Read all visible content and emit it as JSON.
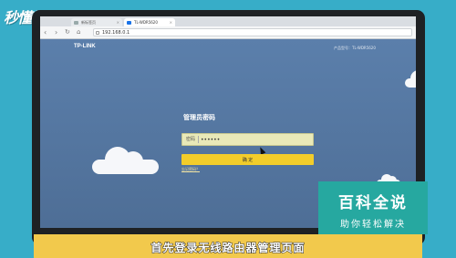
{
  "watermark": "秒懂视频",
  "browser": {
    "tabs": [
      {
        "label": "新标签页"
      },
      {
        "label": "TL-WDR5620"
      }
    ],
    "address": "192.168.0.1"
  },
  "router_page": {
    "brand": "TP-LINK",
    "model": "产品型号：TL-WDR5620",
    "title": "管理员密码",
    "password_label": "密码",
    "password_value": "••••••",
    "confirm_label": "确  定",
    "forgot_link": "忘记密码？"
  },
  "subtitle": "首先登录无线路由器管理页面",
  "badge": {
    "title": "百科全说",
    "slogan": "助你轻松解决"
  }
}
